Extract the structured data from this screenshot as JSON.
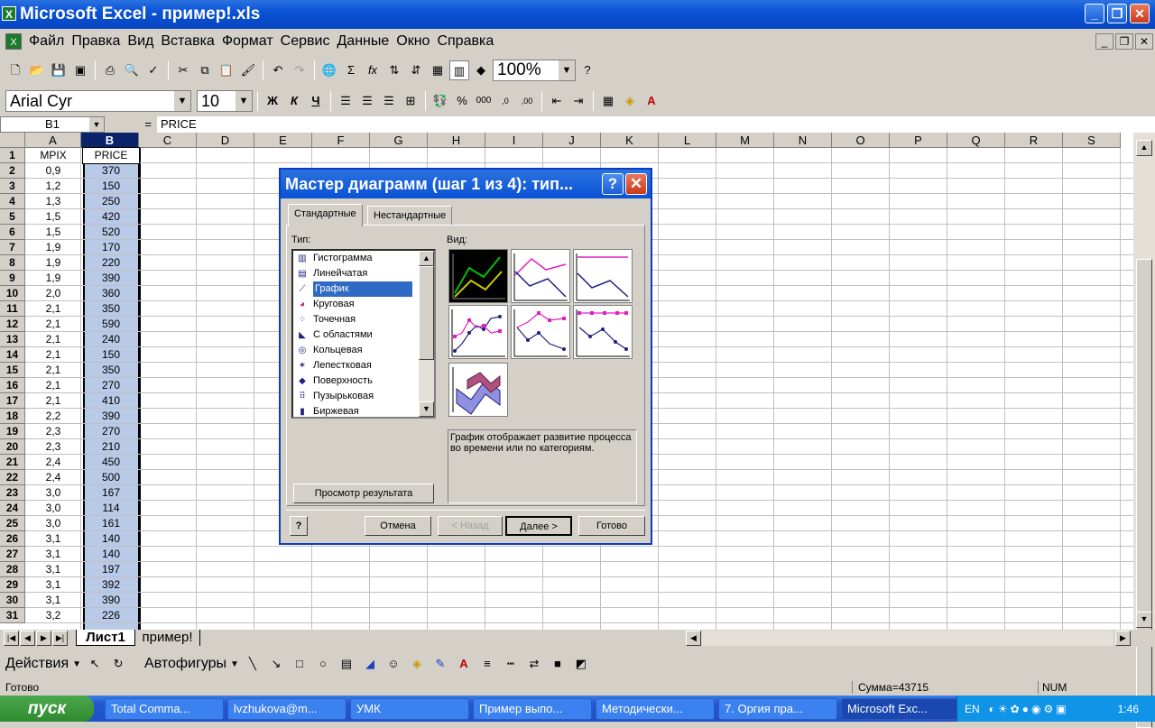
{
  "window": {
    "title": "Microsoft Excel - пример!.xls"
  },
  "menu": [
    "Файл",
    "Правка",
    "Вид",
    "Вставка",
    "Формат",
    "Сервис",
    "Данные",
    "Окно",
    "Справка"
  ],
  "toolbar": {
    "zoom": "100%",
    "font": "Arial Cyr",
    "size": "10"
  },
  "formula": {
    "cell": "B1",
    "eq": "=",
    "value": "PRICE"
  },
  "columns": [
    "A",
    "B",
    "C",
    "D",
    "E",
    "F",
    "G",
    "H",
    "I",
    "J",
    "K",
    "L",
    "M",
    "N",
    "O",
    "P",
    "Q",
    "R",
    "S"
  ],
  "rows": [
    {
      "n": "1",
      "a": "MPIX",
      "b": "PRICE"
    },
    {
      "n": "2",
      "a": "0,9",
      "b": "370"
    },
    {
      "n": "3",
      "a": "1,2",
      "b": "150"
    },
    {
      "n": "4",
      "a": "1,3",
      "b": "250"
    },
    {
      "n": "5",
      "a": "1,5",
      "b": "420"
    },
    {
      "n": "6",
      "a": "1,5",
      "b": "520"
    },
    {
      "n": "7",
      "a": "1,9",
      "b": "170"
    },
    {
      "n": "8",
      "a": "1,9",
      "b": "220"
    },
    {
      "n": "9",
      "a": "1,9",
      "b": "390"
    },
    {
      "n": "10",
      "a": "2,0",
      "b": "360"
    },
    {
      "n": "11",
      "a": "2,1",
      "b": "350"
    },
    {
      "n": "12",
      "a": "2,1",
      "b": "590"
    },
    {
      "n": "13",
      "a": "2,1",
      "b": "240"
    },
    {
      "n": "14",
      "a": "2,1",
      "b": "150"
    },
    {
      "n": "15",
      "a": "2,1",
      "b": "350"
    },
    {
      "n": "16",
      "a": "2,1",
      "b": "270"
    },
    {
      "n": "17",
      "a": "2,1",
      "b": "410"
    },
    {
      "n": "18",
      "a": "2,2",
      "b": "390"
    },
    {
      "n": "19",
      "a": "2,3",
      "b": "270"
    },
    {
      "n": "20",
      "a": "2,3",
      "b": "210"
    },
    {
      "n": "21",
      "a": "2,4",
      "b": "450"
    },
    {
      "n": "22",
      "a": "2,4",
      "b": "500"
    },
    {
      "n": "23",
      "a": "3,0",
      "b": "167"
    },
    {
      "n": "24",
      "a": "3,0",
      "b": "114"
    },
    {
      "n": "25",
      "a": "3,0",
      "b": "161"
    },
    {
      "n": "26",
      "a": "3,1",
      "b": "140"
    },
    {
      "n": "27",
      "a": "3,1",
      "b": "140"
    },
    {
      "n": "28",
      "a": "3,1",
      "b": "197"
    },
    {
      "n": "29",
      "a": "3,1",
      "b": "392"
    },
    {
      "n": "30",
      "a": "3,1",
      "b": "390"
    },
    {
      "n": "31",
      "a": "3,2",
      "b": "226"
    }
  ],
  "sheets": {
    "active": "Лист1",
    "other": "пример!"
  },
  "drawbar": {
    "actions": "Действия",
    "autoshapes": "Автофигуры"
  },
  "status": {
    "ready": "Готово",
    "sum": "Сумма=43715",
    "num": "NUM"
  },
  "dialog": {
    "title": "Мастер диаграмм (шаг 1 из 4): тип...",
    "tab_standard": "Стандартные",
    "tab_custom": "Нестандартные",
    "type_label": "Тип:",
    "view_label": "Вид:",
    "types": [
      "Гистограмма",
      "Линейчатая",
      "График",
      "Круговая",
      "Точечная",
      "С областями",
      "Кольцевая",
      "Лепестковая",
      "Поверхность",
      "Пузырьковая",
      "Биржевая"
    ],
    "description": "График отображает развитие процесса во времени или по категориям.",
    "preview_btn": "Просмотр результата",
    "cancel": "Отмена",
    "back": "< Назад",
    "next": "Далее >",
    "finish": "Готово"
  },
  "taskbar": {
    "start": "пуск",
    "items": [
      "Total Comma...",
      "lvzhukova@m...",
      "УМК",
      "Пример выпо...",
      "Методически...",
      "7. Оргия пра...",
      "Microsoft Exc..."
    ],
    "lang": "EN",
    "time": "1:46"
  }
}
